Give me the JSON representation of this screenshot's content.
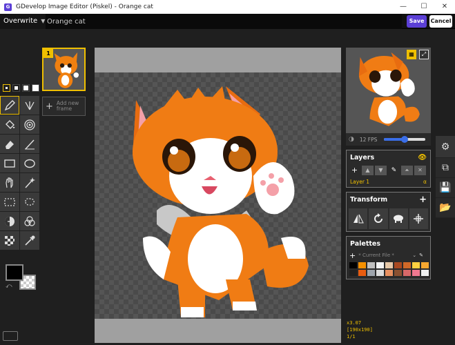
{
  "window": {
    "title": "GDevelop Image Editor (Piskel) - Orange cat",
    "minimize": "—",
    "maximize": "☐",
    "close": "✕"
  },
  "toolbar": {
    "mode": "Overwrite",
    "name_value": "Orange cat",
    "save_label": "Save",
    "cancel_label": "Cancel"
  },
  "tools": [
    "pen",
    "vertical-mirror-pen",
    "paint-bucket",
    "paint-all-same-color",
    "eraser",
    "stroke",
    "rectangle",
    "circle",
    "move",
    "shape-selection",
    "rectangle-selection",
    "lasso-selection",
    "lighten",
    "dithering",
    "checker",
    "color-picker"
  ],
  "colors": {
    "primary": "#000000",
    "secondary": "transparent",
    "accent": "#f0c000",
    "brand": "#5b3fd6"
  },
  "frames": {
    "current_number": "1",
    "add_label": "Add new frame"
  },
  "preview": {
    "fps_label": "12 FPS",
    "fps": 12,
    "fps_max": 24
  },
  "layers": {
    "title": "Layers",
    "items": [
      {
        "name": "Layer 1",
        "opacity_symbol": "α"
      }
    ]
  },
  "transform": {
    "title": "Transform"
  },
  "palettes": {
    "title": "Palettes",
    "current": "* Current File *",
    "swatches": [
      "#000000",
      "#f59000",
      "#c0c0c0",
      "#f4f4f4",
      "#e6c8a8",
      "#a84820",
      "#d06828",
      "#ffd040",
      "#f8a830",
      "#202020",
      "#e85c10",
      "#9ea4ac",
      "#dcdcdc",
      "#e89060",
      "#8a5030",
      "#d86868",
      "#f07890",
      "#f0f0f0"
    ]
  },
  "status": {
    "zoom": "x3.07",
    "size": "[190x190]",
    "frame": "1/1"
  }
}
